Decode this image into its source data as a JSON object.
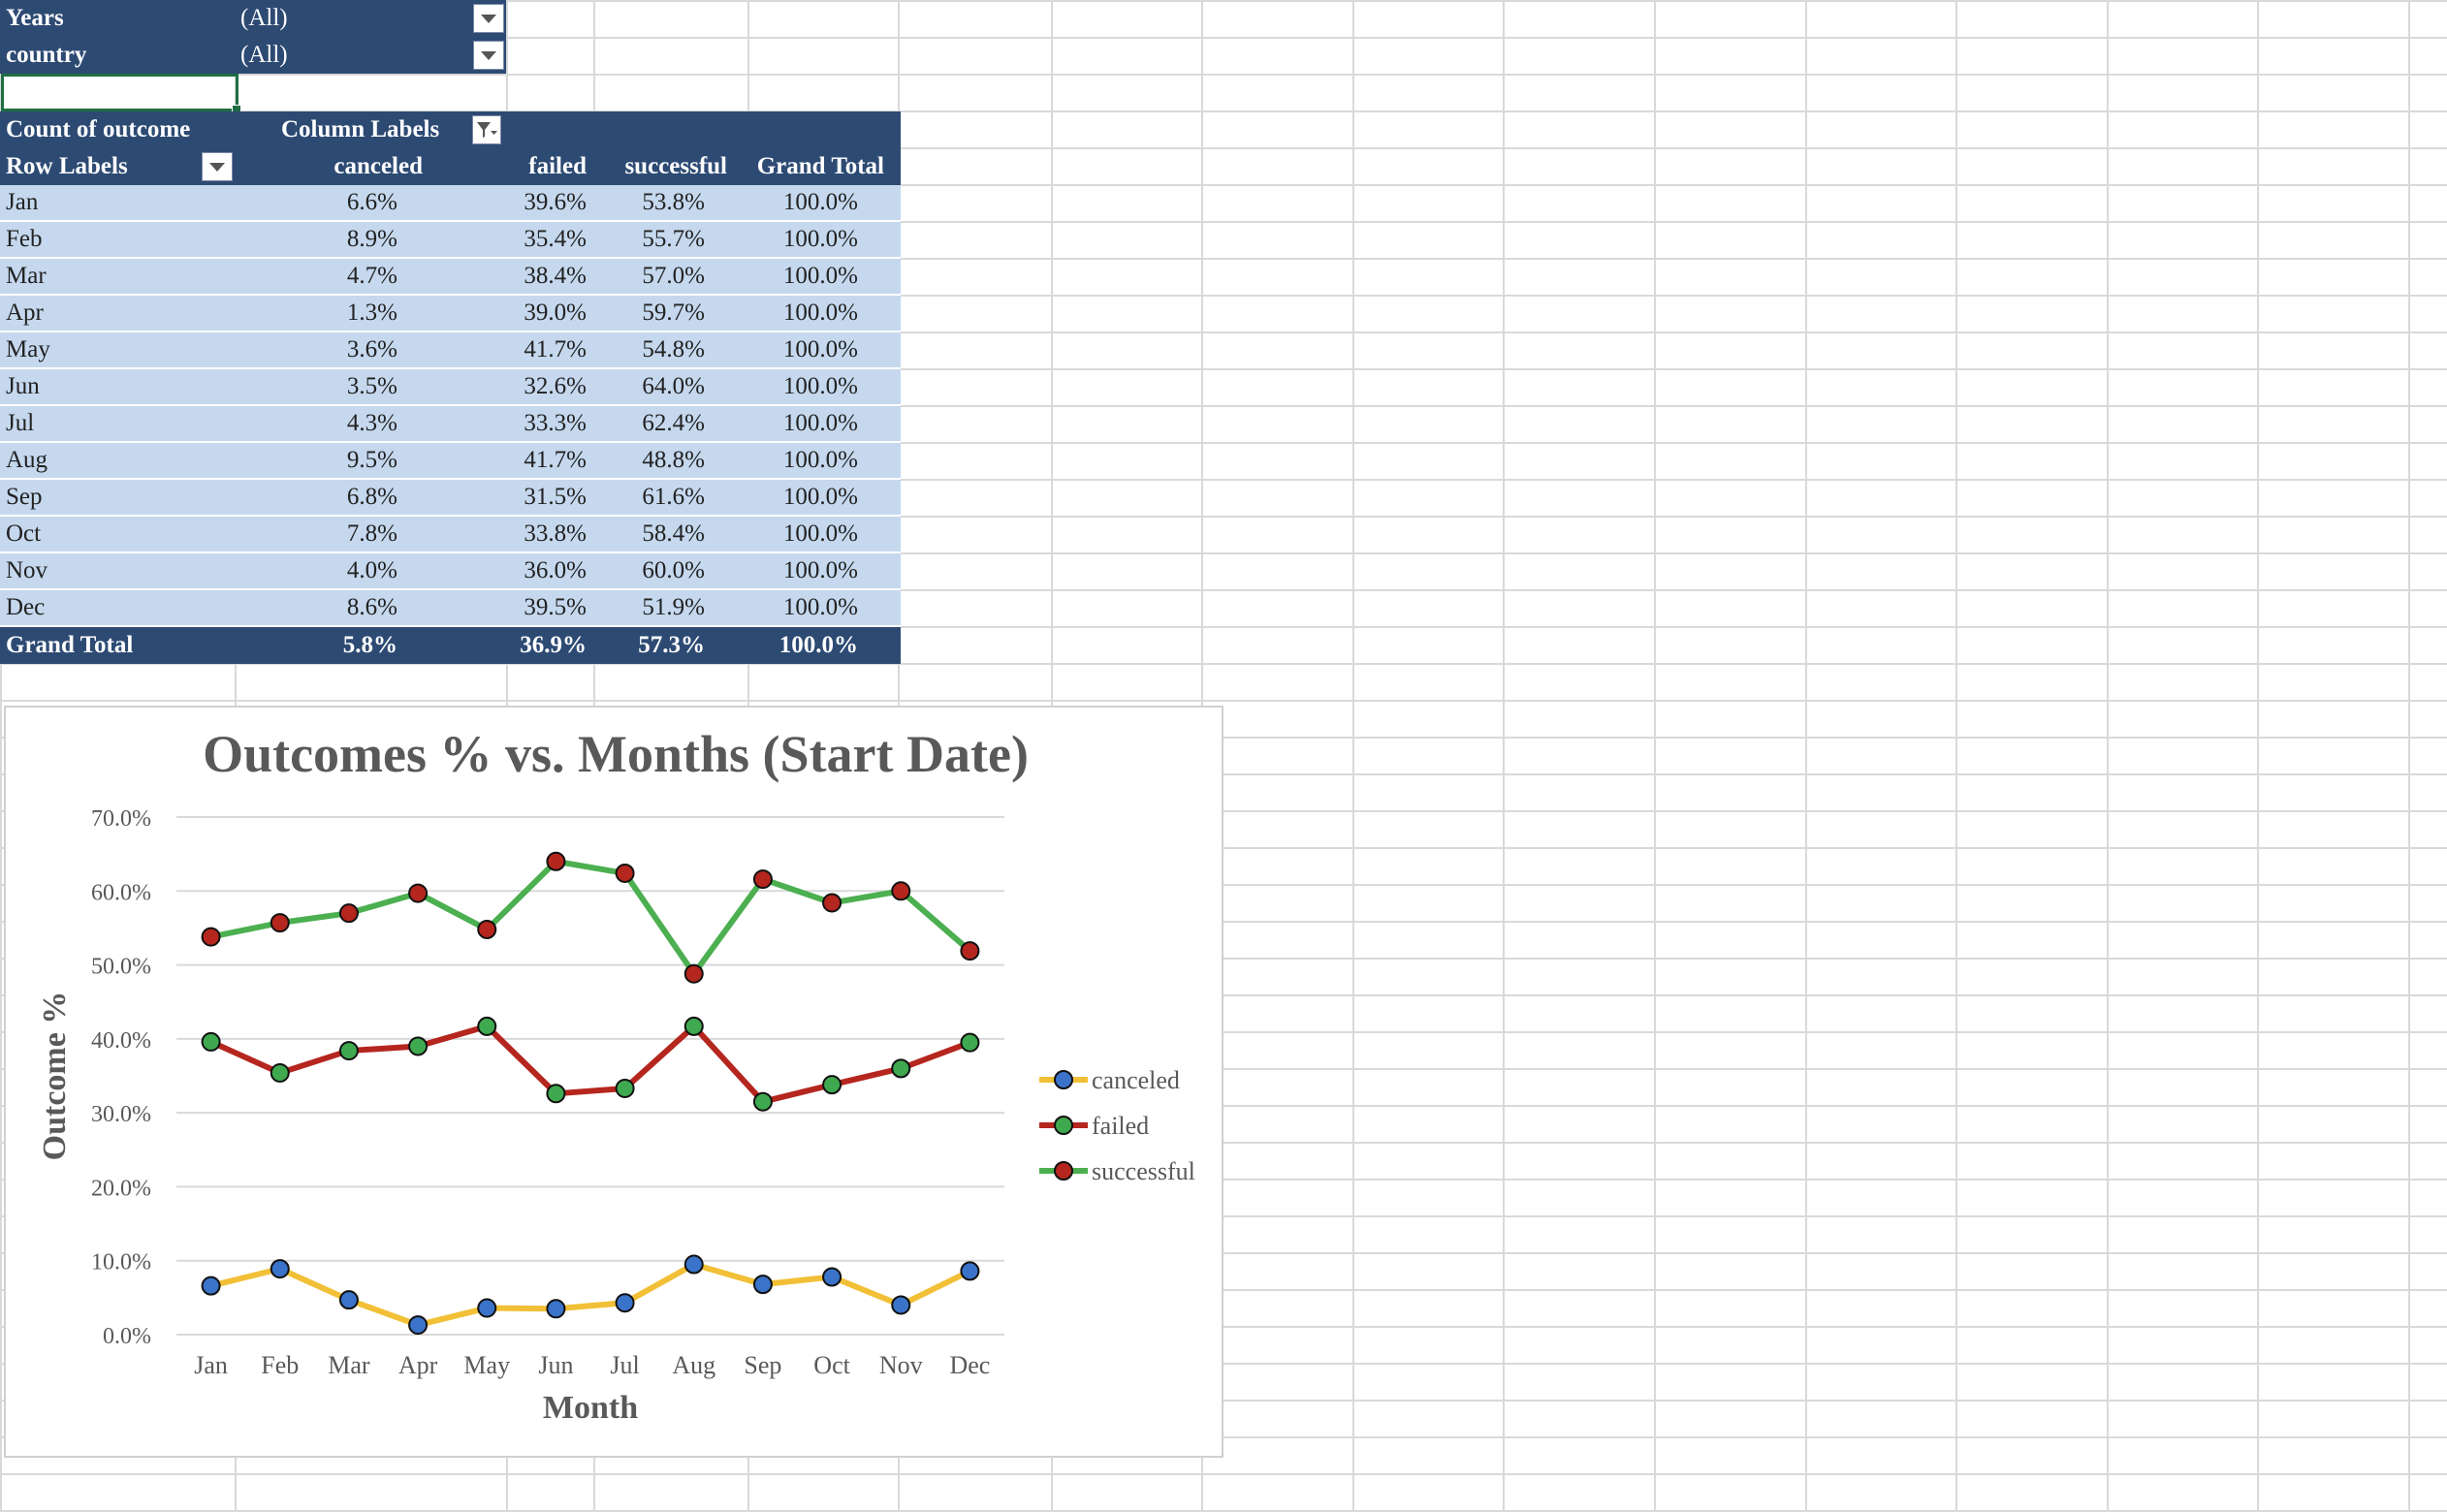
{
  "filters": [
    {
      "label": "Years",
      "value": "(All)"
    },
    {
      "label": "country",
      "value": "(All)"
    }
  ],
  "pivot": {
    "header1": {
      "count_label": "Count of outcome",
      "column_labels": "Column Labels"
    },
    "header2": {
      "row_labels": "Row Labels",
      "cols": [
        "canceled",
        "failed",
        "successful",
        "Grand Total"
      ]
    },
    "rows": [
      {
        "label": "Jan",
        "canceled": "6.6%",
        "failed": "39.6%",
        "successful": "53.8%",
        "total": "100.0%"
      },
      {
        "label": "Feb",
        "canceled": "8.9%",
        "failed": "35.4%",
        "successful": "55.7%",
        "total": "100.0%"
      },
      {
        "label": "Mar",
        "canceled": "4.7%",
        "failed": "38.4%",
        "successful": "57.0%",
        "total": "100.0%"
      },
      {
        "label": "Apr",
        "canceled": "1.3%",
        "failed": "39.0%",
        "successful": "59.7%",
        "total": "100.0%"
      },
      {
        "label": "May",
        "canceled": "3.6%",
        "failed": "41.7%",
        "successful": "54.8%",
        "total": "100.0%"
      },
      {
        "label": "Jun",
        "canceled": "3.5%",
        "failed": "32.6%",
        "successful": "64.0%",
        "total": "100.0%"
      },
      {
        "label": "Jul",
        "canceled": "4.3%",
        "failed": "33.3%",
        "successful": "62.4%",
        "total": "100.0%"
      },
      {
        "label": "Aug",
        "canceled": "9.5%",
        "failed": "41.7%",
        "successful": "48.8%",
        "total": "100.0%"
      },
      {
        "label": "Sep",
        "canceled": "6.8%",
        "failed": "31.5%",
        "successful": "61.6%",
        "total": "100.0%"
      },
      {
        "label": "Oct",
        "canceled": "7.8%",
        "failed": "33.8%",
        "successful": "58.4%",
        "total": "100.0%"
      },
      {
        "label": "Nov",
        "canceled": "4.0%",
        "failed": "36.0%",
        "successful": "60.0%",
        "total": "100.0%"
      },
      {
        "label": "Dec",
        "canceled": "8.6%",
        "failed": "39.5%",
        "successful": "51.9%",
        "total": "100.0%"
      }
    ],
    "grand_total": {
      "label": "Grand Total",
      "canceled": "5.8%",
      "failed": "36.9%",
      "successful": "57.3%",
      "total": "100.0%"
    }
  },
  "colors": {
    "header_bg": "#2d4a73",
    "row_bg": "#c5d8ee",
    "line_canceled": "#f2c037",
    "line_failed": "#b5261e",
    "line_successful": "#4caf50",
    "marker_blue": "#3a73c9",
    "marker_green": "#3fa94f",
    "marker_red": "#b5261e"
  },
  "chart_data": {
    "type": "line",
    "title": "Outcomes % vs. Months (Start Date)",
    "xlabel": "Month",
    "ylabel": "Outcome %",
    "categories": [
      "Jan",
      "Feb",
      "Mar",
      "Apr",
      "May",
      "Jun",
      "Jul",
      "Aug",
      "Sep",
      "Oct",
      "Nov",
      "Dec"
    ],
    "ylim": [
      0,
      70
    ],
    "yticks": [
      "0.0%",
      "10.0%",
      "20.0%",
      "30.0%",
      "40.0%",
      "50.0%",
      "60.0%",
      "70.0%"
    ],
    "grid": true,
    "legend_position": "right",
    "series": [
      {
        "name": "canceled",
        "line_color": "#f2c037",
        "marker_color": "#3a73c9",
        "values": [
          6.6,
          8.9,
          4.7,
          1.3,
          3.6,
          3.5,
          4.3,
          9.5,
          6.8,
          7.8,
          4.0,
          8.6
        ]
      },
      {
        "name": "failed",
        "line_color": "#b5261e",
        "marker_color": "#3fa94f",
        "values": [
          39.6,
          35.4,
          38.4,
          39.0,
          41.7,
          32.6,
          33.3,
          41.7,
          31.5,
          33.8,
          36.0,
          39.5
        ]
      },
      {
        "name": "successful",
        "line_color": "#4caf50",
        "marker_color": "#b5261e",
        "values": [
          53.8,
          55.7,
          57.0,
          59.7,
          54.8,
          64.0,
          62.4,
          48.8,
          61.6,
          58.4,
          60.0,
          51.9
        ]
      }
    ]
  }
}
